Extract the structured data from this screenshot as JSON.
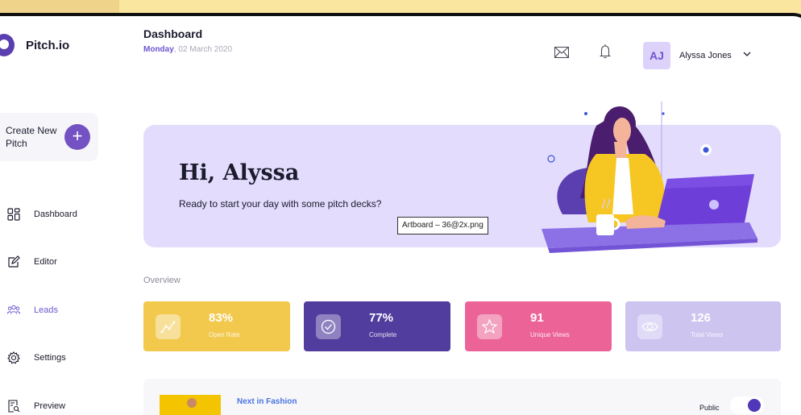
{
  "app": {
    "name": "Pitch.io"
  },
  "sidebar": {
    "create_label": "Create New Pitch",
    "create_icon": "plus-icon",
    "items": [
      {
        "label": "Dashboard",
        "icon": "grid-icon"
      },
      {
        "label": "Editor",
        "icon": "edit-icon"
      },
      {
        "label": "Leads",
        "icon": "users-icon",
        "active": true
      },
      {
        "label": "Settings",
        "icon": "gear-icon"
      },
      {
        "label": "Preview",
        "icon": "preview-icon"
      }
    ]
  },
  "header": {
    "title": "Dashboard",
    "day": "Monday",
    "date": ", 02 March 2020",
    "user_initials": "AJ",
    "user_name": "Alyssa Jones"
  },
  "hero": {
    "title": "Hi, Alyssa",
    "subtitle": "Ready to start your day with some pitch decks?",
    "tooltip": "Artboard – 36@2x.png"
  },
  "overview": {
    "label": "Overview",
    "cards": [
      {
        "value": "83%",
        "label": "Open Rate",
        "color": "#f2c94c",
        "icon": "trend-icon"
      },
      {
        "value": "77%",
        "label": "Complete",
        "color": "#503d9e",
        "icon": "check-circle-icon"
      },
      {
        "value": "91",
        "label": "Unique Views",
        "color": "#ec6497",
        "icon": "star-icon"
      },
      {
        "value": "126",
        "label": "Total Views",
        "color": "#cdc4f0",
        "icon": "eye-icon"
      }
    ]
  },
  "pitches": [
    {
      "title": "Next in Fashion",
      "visibility": "Public",
      "public_enabled": true
    }
  ],
  "colors": {
    "accent": "#6e56cf",
    "hero_bg": "#e3dcfc"
  }
}
